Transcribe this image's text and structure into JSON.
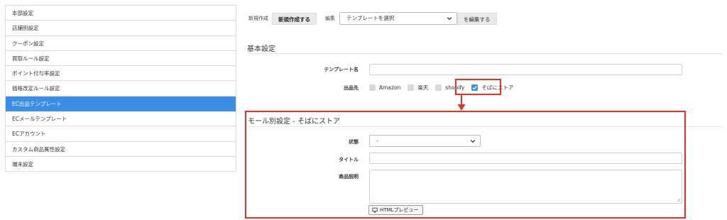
{
  "sidebar": {
    "items": [
      {
        "label": "本部設定"
      },
      {
        "label": "店舗別設定"
      },
      {
        "label": "クーポン設定"
      },
      {
        "label": "買取ルール設定"
      },
      {
        "label": "ポイント付与率設定"
      },
      {
        "label": "価格改定ルール設定"
      },
      {
        "label": "EC出品テンプレート",
        "active": true
      },
      {
        "label": "ECメールテンプレート"
      },
      {
        "label": "ECアカウント"
      },
      {
        "label": "カスタム商品属性設定"
      },
      {
        "label": "端末設定"
      }
    ]
  },
  "toolbar": {
    "new_label": "新規作成",
    "new_button": "新規作成する",
    "edit_label": "編集",
    "template_select": "テンプレートを選択",
    "edit_button": "を編集する"
  },
  "basic": {
    "title": "基本設定",
    "template_name_label": "テンプレート名",
    "template_name_value": "",
    "channel_label": "出品先",
    "channels": [
      {
        "label": "Amazon",
        "checked": false
      },
      {
        "label": "楽天",
        "checked": false
      },
      {
        "label": "shopify",
        "checked": false
      },
      {
        "label": "そばにストア",
        "checked": true
      }
    ]
  },
  "mall": {
    "title": "モール別設定 - そばにストア",
    "status_label": "状態",
    "status_value": "-",
    "title_label": "タイトル",
    "title_value": "",
    "description_label": "商品説明",
    "description_value": "",
    "preview_button": "HTMLプレビュー"
  },
  "colors": {
    "accent": "#3a8ee6",
    "highlight": "#e53224"
  }
}
